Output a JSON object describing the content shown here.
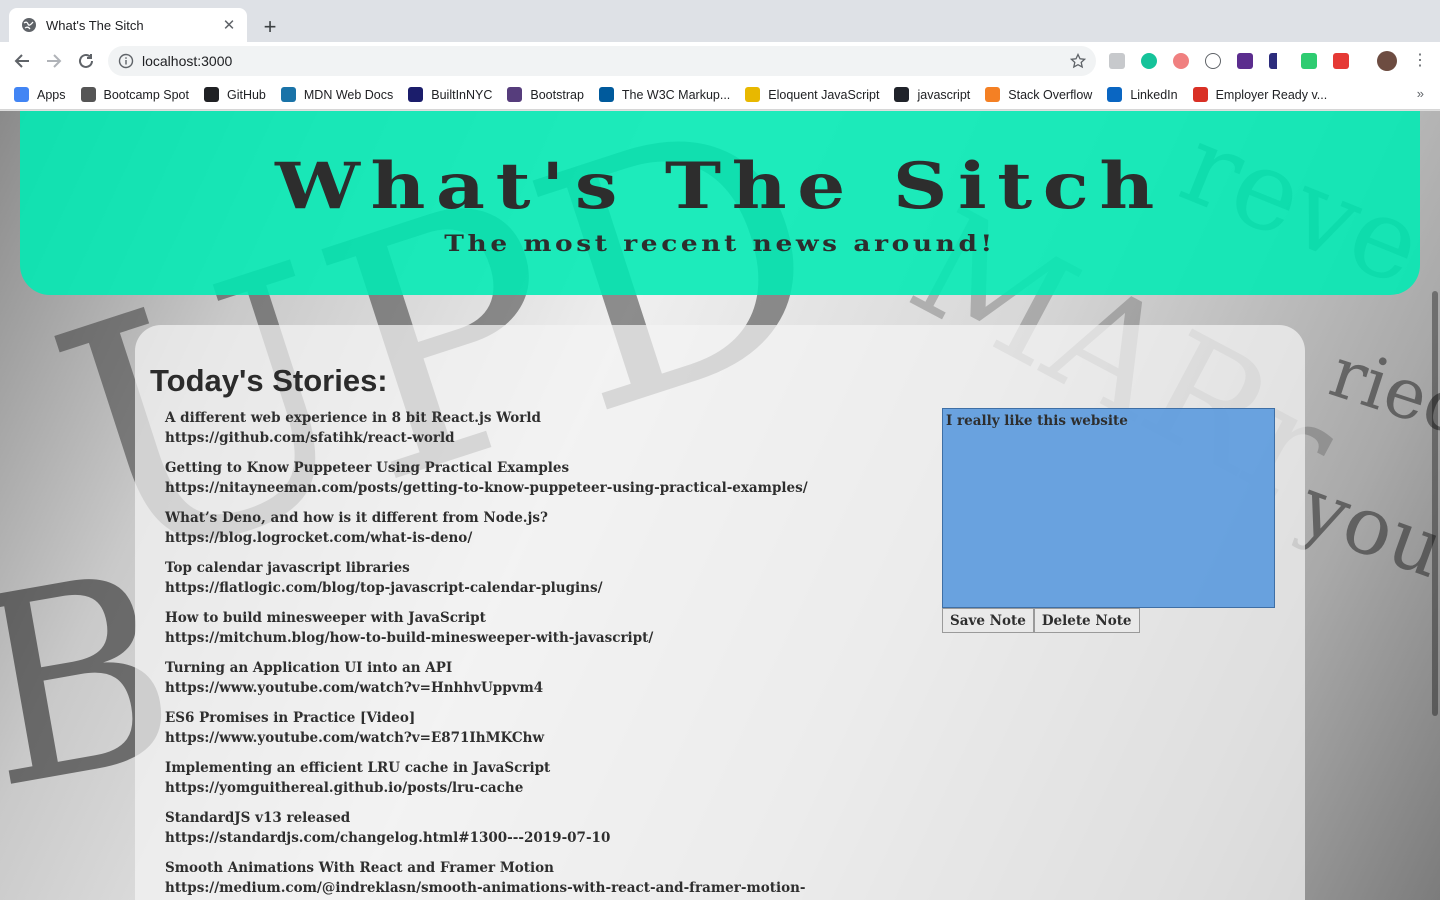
{
  "browser": {
    "tab_title": "What's The Sitch",
    "url": "localhost:3000",
    "bookmarks": [
      {
        "label": "Apps",
        "icon": "apps-grid-icon",
        "color": "#4285f4"
      },
      {
        "label": "Bootcamp Spot",
        "icon": "bootcamp-spot-icon",
        "color": "#555555"
      },
      {
        "label": "GitHub",
        "icon": "github-icon",
        "color": "#202124"
      },
      {
        "label": "MDN Web Docs",
        "icon": "mdn-icon",
        "color": "#1a73a8"
      },
      {
        "label": "BuiltInNYC",
        "icon": "builtin-icon",
        "color": "#1b1d6b"
      },
      {
        "label": "Bootstrap",
        "icon": "bootstrap-icon",
        "color": "#563d7c"
      },
      {
        "label": "The W3C Markup...",
        "icon": "w3c-icon",
        "color": "#005a9c"
      },
      {
        "label": "Eloquent JavaScript",
        "icon": "ejs-icon",
        "color": "#e8b800"
      },
      {
        "label": "javascript",
        "icon": "react-icon",
        "color": "#20232a"
      },
      {
        "label": "Stack Overflow",
        "icon": "stackoverflow-icon",
        "color": "#f48024"
      },
      {
        "label": "LinkedIn",
        "icon": "linkedin-icon",
        "color": "#0a66c2"
      },
      {
        "label": "Employer Ready v...",
        "icon": "pdf-icon",
        "color": "#d93025"
      }
    ]
  },
  "header": {
    "title": "What's The Sitch",
    "subtitle": "The most recent news around!"
  },
  "main": {
    "section_title": "Today's Stories:",
    "stories": [
      {
        "title": "A different web experience in 8 bit React.js World",
        "link": "https://github.com/sfatihk/react-world"
      },
      {
        "title": "Getting to Know Puppeteer Using Practical Examples",
        "link": "https://nitayneeman.com/posts/getting-to-know-puppeteer-using-practical-examples/"
      },
      {
        "title": "What’s Deno, and how is it different from Node.js?",
        "link": "https://blog.logrocket.com/what-is-deno/"
      },
      {
        "title": "Top calendar javascript libraries",
        "link": "https://flatlogic.com/blog/top-javascript-calendar-plugins/"
      },
      {
        "title": "How to build minesweeper with JavaScript",
        "link": "https://mitchum.blog/how-to-build-minesweeper-with-javascript/"
      },
      {
        "title": "Turning an Application UI into an API",
        "link": "https://www.youtube.com/watch?v=HnhhvUppvm4"
      },
      {
        "title": "ES6 Promises in Practice [Video]",
        "link": "https://www.youtube.com/watch?v=E871IhMKChw"
      },
      {
        "title": "Implementing an efficient LRU cache in JavaScript",
        "link": "https://yomguithereal.github.io/posts/lru-cache"
      },
      {
        "title": "StandardJS v13 released",
        "link": "https://standardjs.com/changelog.html#1300---2019-07-10"
      },
      {
        "title": "Smooth Animations With React and Framer Motion",
        "link": "https://medium.com/@indreklasn/smooth-animations-with-react-and-framer-motion-"
      }
    ]
  },
  "notes": {
    "text": "I really like this website",
    "save_label": "Save Note",
    "delete_label": "Delete Note"
  }
}
